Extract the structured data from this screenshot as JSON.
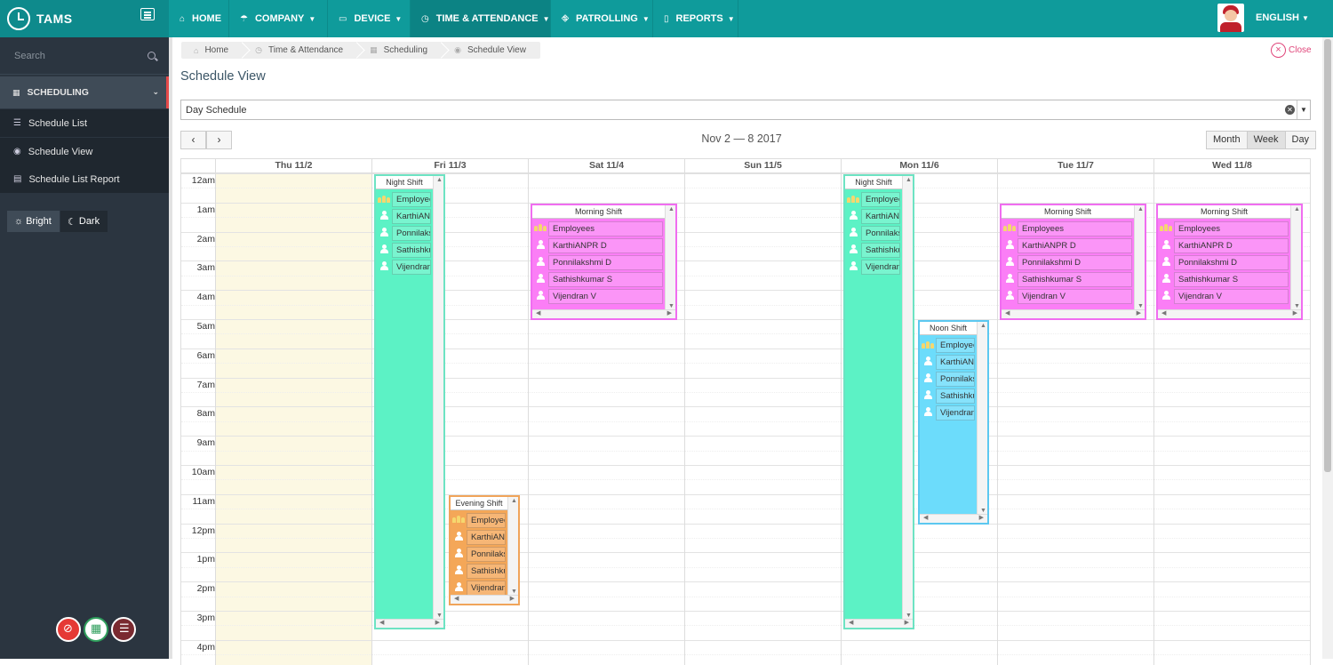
{
  "app": {
    "name": "TAMS"
  },
  "topnav": [
    {
      "label": "HOME",
      "icon": "home-icon"
    },
    {
      "label": "COMPANY",
      "icon": "umbrella-icon"
    },
    {
      "label": "DEVICE",
      "icon": "laptop-icon"
    },
    {
      "label": "TIME & ATTENDANCE",
      "icon": "clock-icon",
      "active": true
    },
    {
      "label": "PATROLLING",
      "icon": "road-icon"
    },
    {
      "label": "REPORTS",
      "icon": "file-icon"
    }
  ],
  "language": "ENGLISH",
  "sidebar": {
    "search_placeholder": "Search",
    "section": "SCHEDULING",
    "items": [
      {
        "label": "Schedule List",
        "icon": "list-icon"
      },
      {
        "label": "Schedule View",
        "icon": "eye-icon"
      },
      {
        "label": "Schedule List Report",
        "icon": "book-icon"
      }
    ],
    "themes": {
      "bright": "Bright",
      "dark": "Dark"
    }
  },
  "breadcrumb": [
    {
      "label": "Home",
      "icon": "home-icon"
    },
    {
      "label": "Time & Attendance",
      "icon": "clock-icon"
    },
    {
      "label": "Scheduling",
      "icon": "calendar-icon"
    },
    {
      "label": "Schedule View",
      "icon": "eye-icon"
    }
  ],
  "close_label": "Close",
  "page_title": "Schedule View",
  "schedule_select": {
    "value": "Day Schedule"
  },
  "calendar": {
    "title": "Nov 2 — 8 2017",
    "views": [
      "Month",
      "Week",
      "Day"
    ],
    "active_view": "Week",
    "days": [
      "Thu 11/2",
      "Fri 11/3",
      "Sat 11/4",
      "Sun 11/5",
      "Mon 11/6",
      "Tue 11/7",
      "Wed 11/8"
    ],
    "hours": [
      "12am",
      "1am",
      "2am",
      "3am",
      "4am",
      "5am",
      "6am",
      "7am",
      "8am",
      "9am",
      "10am",
      "11am",
      "12pm",
      "1pm",
      "2pm",
      "3pm",
      "4pm"
    ],
    "today_index": 0,
    "events": [
      {
        "name": "Night Shift",
        "day": 1,
        "start": 0,
        "end": 15.6,
        "col": 0,
        "border": "#6de3c3",
        "fill": "#5cf2c5",
        "rows": [
          "Employees",
          "KarthiANPR D",
          "Ponnilakshmi D",
          "Sathishkumar S",
          "Vijendran V"
        ]
      },
      {
        "name": "Evening Shift",
        "day": 1,
        "start": 11,
        "end": 14.8,
        "col": 1,
        "border": "#f0a45a",
        "fill": "#f4a758",
        "rows": [
          "Employees",
          "KarthiANPR D",
          "Ponnilakshmi D",
          "Sathishkumar S",
          "Vijendran V"
        ]
      },
      {
        "name": "Morning Shift",
        "day": 2,
        "start": 1,
        "end": 5,
        "col": 0,
        "border": "#f06df0",
        "fill": "#fb7ef6",
        "rows": [
          "Employees",
          "KarthiANPR D",
          "Ponnilakshmi D",
          "Sathishkumar S",
          "Vijendran V"
        ]
      },
      {
        "name": "Night Shift",
        "day": 4,
        "start": 0,
        "end": 15.6,
        "col": 0,
        "border": "#6de3c3",
        "fill": "#5cf2c5",
        "rows": [
          "Employees",
          "KarthiANPR D",
          "Ponnilakshmi D",
          "Sathishkumar S",
          "Vijendran V"
        ]
      },
      {
        "name": "Noon Shift",
        "day": 4,
        "start": 5,
        "end": 12,
        "col": 1,
        "border": "#5cc8f0",
        "fill": "#6cdcfb",
        "rows": [
          "Employees",
          "KarthiANPR D",
          "Ponnilakshmi D",
          "Sathishkumar S",
          "Vijendran V"
        ]
      },
      {
        "name": "Morning Shift",
        "day": 5,
        "start": 1,
        "end": 5,
        "col": 0,
        "border": "#f06df0",
        "fill": "#fb7ef6",
        "rows": [
          "Employees",
          "KarthiANPR D",
          "Ponnilakshmi D",
          "Sathishkumar S",
          "Vijendran V"
        ]
      },
      {
        "name": "Morning Shift",
        "day": 6,
        "start": 1,
        "end": 5,
        "col": 0,
        "border": "#f06df0",
        "fill": "#fb7ef6",
        "rows": [
          "Employees",
          "KarthiANPR D",
          "Ponnilakshmi D",
          "Sathishkumar S",
          "Vijendran V"
        ]
      }
    ]
  },
  "colors": {
    "topbar": "#0f9b9b",
    "sidebar": "#2b3540",
    "today": "#fcf8e3",
    "accent_close": "#e0457a"
  }
}
